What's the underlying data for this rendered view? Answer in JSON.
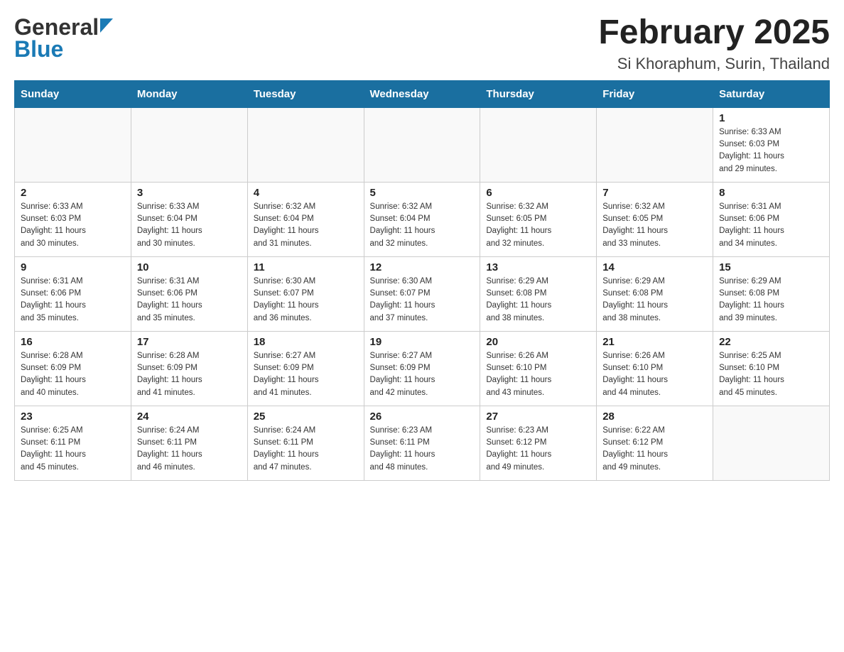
{
  "header": {
    "logo_general": "General",
    "logo_blue": "Blue",
    "title": "February 2025",
    "subtitle": "Si Khoraphum, Surin, Thailand"
  },
  "days_of_week": [
    "Sunday",
    "Monday",
    "Tuesday",
    "Wednesday",
    "Thursday",
    "Friday",
    "Saturday"
  ],
  "weeks": [
    [
      {
        "day": "",
        "info": ""
      },
      {
        "day": "",
        "info": ""
      },
      {
        "day": "",
        "info": ""
      },
      {
        "day": "",
        "info": ""
      },
      {
        "day": "",
        "info": ""
      },
      {
        "day": "",
        "info": ""
      },
      {
        "day": "1",
        "info": "Sunrise: 6:33 AM\nSunset: 6:03 PM\nDaylight: 11 hours\nand 29 minutes."
      }
    ],
    [
      {
        "day": "2",
        "info": "Sunrise: 6:33 AM\nSunset: 6:03 PM\nDaylight: 11 hours\nand 30 minutes."
      },
      {
        "day": "3",
        "info": "Sunrise: 6:33 AM\nSunset: 6:04 PM\nDaylight: 11 hours\nand 30 minutes."
      },
      {
        "day": "4",
        "info": "Sunrise: 6:32 AM\nSunset: 6:04 PM\nDaylight: 11 hours\nand 31 minutes."
      },
      {
        "day": "5",
        "info": "Sunrise: 6:32 AM\nSunset: 6:04 PM\nDaylight: 11 hours\nand 32 minutes."
      },
      {
        "day": "6",
        "info": "Sunrise: 6:32 AM\nSunset: 6:05 PM\nDaylight: 11 hours\nand 32 minutes."
      },
      {
        "day": "7",
        "info": "Sunrise: 6:32 AM\nSunset: 6:05 PM\nDaylight: 11 hours\nand 33 minutes."
      },
      {
        "day": "8",
        "info": "Sunrise: 6:31 AM\nSunset: 6:06 PM\nDaylight: 11 hours\nand 34 minutes."
      }
    ],
    [
      {
        "day": "9",
        "info": "Sunrise: 6:31 AM\nSunset: 6:06 PM\nDaylight: 11 hours\nand 35 minutes."
      },
      {
        "day": "10",
        "info": "Sunrise: 6:31 AM\nSunset: 6:06 PM\nDaylight: 11 hours\nand 35 minutes."
      },
      {
        "day": "11",
        "info": "Sunrise: 6:30 AM\nSunset: 6:07 PM\nDaylight: 11 hours\nand 36 minutes."
      },
      {
        "day": "12",
        "info": "Sunrise: 6:30 AM\nSunset: 6:07 PM\nDaylight: 11 hours\nand 37 minutes."
      },
      {
        "day": "13",
        "info": "Sunrise: 6:29 AM\nSunset: 6:08 PM\nDaylight: 11 hours\nand 38 minutes."
      },
      {
        "day": "14",
        "info": "Sunrise: 6:29 AM\nSunset: 6:08 PM\nDaylight: 11 hours\nand 38 minutes."
      },
      {
        "day": "15",
        "info": "Sunrise: 6:29 AM\nSunset: 6:08 PM\nDaylight: 11 hours\nand 39 minutes."
      }
    ],
    [
      {
        "day": "16",
        "info": "Sunrise: 6:28 AM\nSunset: 6:09 PM\nDaylight: 11 hours\nand 40 minutes."
      },
      {
        "day": "17",
        "info": "Sunrise: 6:28 AM\nSunset: 6:09 PM\nDaylight: 11 hours\nand 41 minutes."
      },
      {
        "day": "18",
        "info": "Sunrise: 6:27 AM\nSunset: 6:09 PM\nDaylight: 11 hours\nand 41 minutes."
      },
      {
        "day": "19",
        "info": "Sunrise: 6:27 AM\nSunset: 6:09 PM\nDaylight: 11 hours\nand 42 minutes."
      },
      {
        "day": "20",
        "info": "Sunrise: 6:26 AM\nSunset: 6:10 PM\nDaylight: 11 hours\nand 43 minutes."
      },
      {
        "day": "21",
        "info": "Sunrise: 6:26 AM\nSunset: 6:10 PM\nDaylight: 11 hours\nand 44 minutes."
      },
      {
        "day": "22",
        "info": "Sunrise: 6:25 AM\nSunset: 6:10 PM\nDaylight: 11 hours\nand 45 minutes."
      }
    ],
    [
      {
        "day": "23",
        "info": "Sunrise: 6:25 AM\nSunset: 6:11 PM\nDaylight: 11 hours\nand 45 minutes."
      },
      {
        "day": "24",
        "info": "Sunrise: 6:24 AM\nSunset: 6:11 PM\nDaylight: 11 hours\nand 46 minutes."
      },
      {
        "day": "25",
        "info": "Sunrise: 6:24 AM\nSunset: 6:11 PM\nDaylight: 11 hours\nand 47 minutes."
      },
      {
        "day": "26",
        "info": "Sunrise: 6:23 AM\nSunset: 6:11 PM\nDaylight: 11 hours\nand 48 minutes."
      },
      {
        "day": "27",
        "info": "Sunrise: 6:23 AM\nSunset: 6:12 PM\nDaylight: 11 hours\nand 49 minutes."
      },
      {
        "day": "28",
        "info": "Sunrise: 6:22 AM\nSunset: 6:12 PM\nDaylight: 11 hours\nand 49 minutes."
      },
      {
        "day": "",
        "info": ""
      }
    ]
  ]
}
